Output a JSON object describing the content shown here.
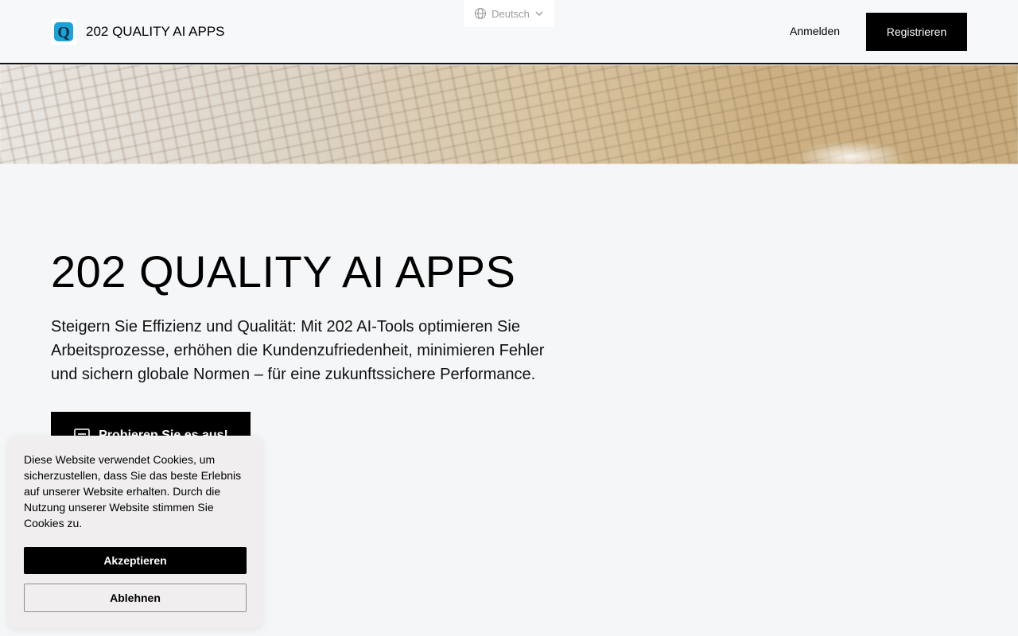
{
  "header": {
    "brand_name": "202 QUALITY AI APPS",
    "logo_letter": "Q",
    "language": "Deutsch",
    "login_label": "Anmelden",
    "register_label": "Registrieren"
  },
  "hero": {
    "title": "202 QUALITY AI APPS",
    "description": "Steigern Sie Effizienz und Qualität: Mit 202 AI-Tools optimieren Sie Arbeitsprozesse, erhöhen die Kundenzufriedenheit, minimieren Fehler und sichern globale Normen – für eine zukunftssichere Performance.",
    "cta_label": "Probieren Sie es aus!"
  },
  "cookie_banner": {
    "text": "Diese Website verwendet Cookies, um sicherzustellen, dass Sie das beste Erlebnis auf unserer Website erhalten. Durch die Nutzung unserer Website stimmen Sie Cookies zu.",
    "accept_label": "Akzeptieren",
    "decline_label": "Ablehnen"
  },
  "colors": {
    "primary": "#000000",
    "background": "#f5f6f8",
    "logo_accent": "#1aa3d9",
    "cookie_bg": "#f0eeee"
  },
  "icons": [
    "logo-icon",
    "globe-icon",
    "chevron-down-icon",
    "document-icon"
  ]
}
